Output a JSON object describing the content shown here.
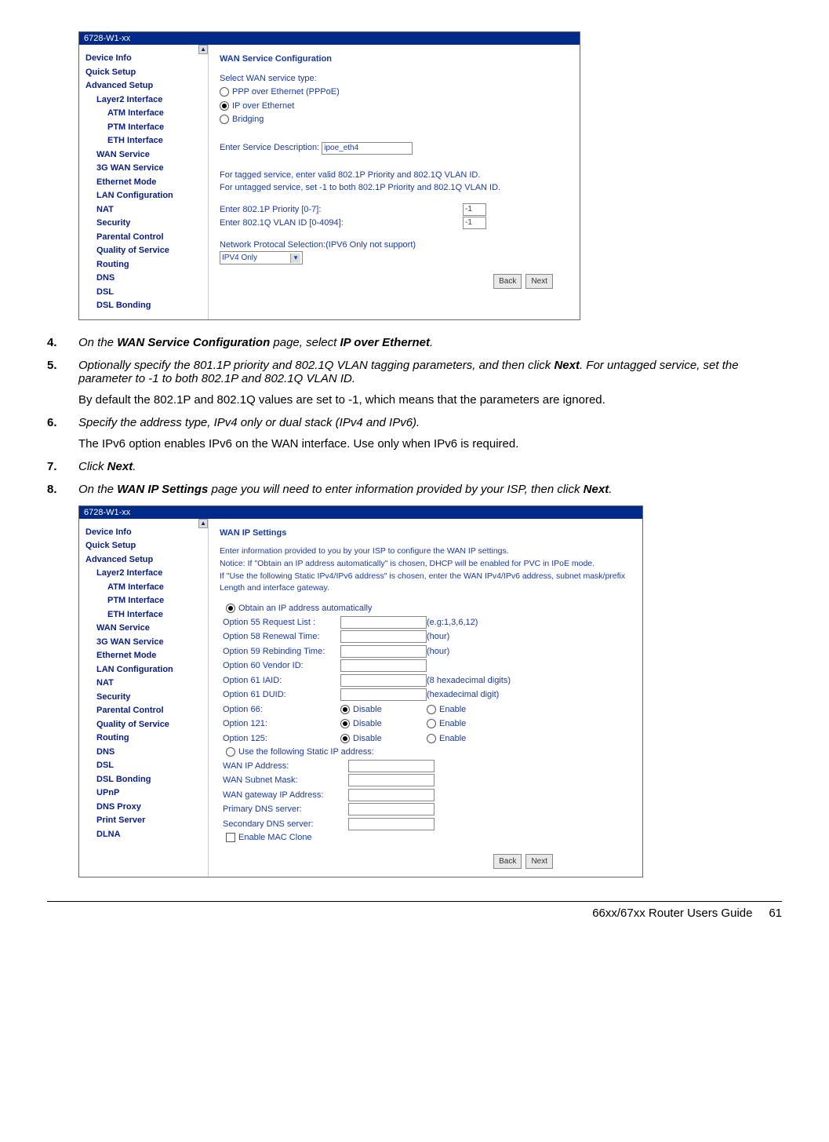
{
  "titlebar": "6728-W1-xx",
  "sidebar": {
    "short": [
      {
        "lvl": 1,
        "label": "Device Info"
      },
      {
        "lvl": 1,
        "label": "Quick Setup"
      },
      {
        "lvl": 1,
        "label": "Advanced Setup"
      },
      {
        "lvl": 2,
        "label": "Layer2 Interface"
      },
      {
        "lvl": 3,
        "label": "ATM Interface"
      },
      {
        "lvl": 3,
        "label": "PTM Interface"
      },
      {
        "lvl": 3,
        "label": "ETH Interface"
      },
      {
        "lvl": 2,
        "label": "WAN Service"
      },
      {
        "lvl": 2,
        "label": "3G WAN Service"
      },
      {
        "lvl": 2,
        "label": "Ethernet Mode"
      },
      {
        "lvl": 2,
        "label": "LAN Configuration"
      },
      {
        "lvl": 2,
        "label": "NAT"
      },
      {
        "lvl": 2,
        "label": "Security"
      },
      {
        "lvl": 2,
        "label": "Parental Control"
      },
      {
        "lvl": 2,
        "label": "Quality of Service"
      },
      {
        "lvl": 2,
        "label": "Routing"
      },
      {
        "lvl": 2,
        "label": "DNS"
      },
      {
        "lvl": 2,
        "label": "DSL"
      },
      {
        "lvl": 2,
        "label": "DSL Bonding"
      }
    ],
    "long": [
      {
        "lvl": 1,
        "label": "Device Info"
      },
      {
        "lvl": 1,
        "label": "Quick Setup"
      },
      {
        "lvl": 1,
        "label": "Advanced Setup"
      },
      {
        "lvl": 2,
        "label": "Layer2 Interface"
      },
      {
        "lvl": 3,
        "label": "ATM Interface"
      },
      {
        "lvl": 3,
        "label": "PTM Interface"
      },
      {
        "lvl": 3,
        "label": "ETH Interface"
      },
      {
        "lvl": 2,
        "label": "WAN Service"
      },
      {
        "lvl": 2,
        "label": "3G WAN Service"
      },
      {
        "lvl": 2,
        "label": "Ethernet Mode"
      },
      {
        "lvl": 2,
        "label": "LAN Configuration"
      },
      {
        "lvl": 2,
        "label": "NAT"
      },
      {
        "lvl": 2,
        "label": "Security"
      },
      {
        "lvl": 2,
        "label": "Parental Control"
      },
      {
        "lvl": 2,
        "label": "Quality of Service"
      },
      {
        "lvl": 2,
        "label": "Routing"
      },
      {
        "lvl": 2,
        "label": "DNS"
      },
      {
        "lvl": 2,
        "label": "DSL"
      },
      {
        "lvl": 2,
        "label": "DSL Bonding"
      },
      {
        "lvl": 2,
        "label": "UPnP"
      },
      {
        "lvl": 2,
        "label": "DNS Proxy"
      },
      {
        "lvl": 2,
        "label": "Print Server"
      },
      {
        "lvl": 2,
        "label": "DLNA"
      }
    ]
  },
  "screenshot1": {
    "heading": "WAN Service Configuration",
    "prompt": "Select WAN service type:",
    "opt1": "PPP over Ethernet (PPPoE)",
    "opt2": "IP over Ethernet",
    "opt3": "Bridging",
    "desc_label": "Enter Service Description:",
    "desc_value": "ipoe_eth4",
    "tagged": "For tagged service, enter valid 802.1P Priority and 802.1Q VLAN ID.",
    "untagged": "For untagged service, set -1 to both 802.1P Priority and 802.1Q VLAN ID.",
    "priority_label": "Enter 802.1P Priority [0-7]:",
    "priority_value": "-1",
    "vlan_label": "Enter 802.1Q VLAN ID [0-4094]:",
    "vlan_value": "-1",
    "proto_label": "Network Protocal Selection:(IPV6 Only not support)",
    "proto_value": "IPV4 Only",
    "back": "Back",
    "next": "Next"
  },
  "screenshot2": {
    "heading": "WAN IP Settings",
    "intro1": "Enter information provided to you by your ISP to configure the WAN IP settings.",
    "intro2": "Notice: If \"Obtain an IP address automatically\" is chosen, DHCP will be enabled for PVC in IPoE mode.",
    "intro3": "If \"Use the following Static IPv4/IPv6 address\" is chosen, enter the WAN IPv4/IPv6 address, subnet mask/prefix Length and interface gateway.",
    "obtain": "Obtain an IP address automatically",
    "opt55_label": "Option 55 Request List :",
    "opt55_hint": "(e.g:1,3,6,12)",
    "opt58_label": "Option 58 Renewal Time:",
    "opt58_hint": "(hour)",
    "opt59_label": "Option 59 Rebinding Time:",
    "opt59_hint": "(hour)",
    "opt60_label": "Option 60 Vendor ID:",
    "opt61i_label": "Option 61 IAID:",
    "opt61i_hint": "(8 hexadecimal digits)",
    "opt61d_label": "Option 61 DUID:",
    "opt61d_hint": "(hexadecimal digit)",
    "opt66_label": "Option 66:",
    "opt121_label": "Option 121:",
    "opt125_label": "Option 125:",
    "disable": "Disable",
    "enable": "Enable",
    "static": "Use the following Static IP address:",
    "wanip": "WAN IP Address:",
    "wanmask": "WAN Subnet Mask:",
    "wangw": "WAN gateway IP Address:",
    "dns1": "Primary DNS server:",
    "dns2": "Secondary DNS server:",
    "mac": "Enable MAC Clone",
    "back": "Back",
    "next": "Next"
  },
  "steps": {
    "s4_num": "4.",
    "s4_a": "On the ",
    "s4_b": "WAN Service Configuration",
    "s4_c": " page, select ",
    "s4_d": "IP over Ethernet",
    "s4_e": ".",
    "s5_num": "5.",
    "s5_a": "Optionally specify the 801.1P priority and 802.1Q VLAN tagging parameters, and then click ",
    "s5_b": "Next",
    "s5_c": ".  For untagged service, set the parameter to -1 to both 802.1P and 802.1Q VLAN ID.",
    "s5_note": "By default the 802.1P and 802.1Q values are set to -1, which means that the parameters are ignored.",
    "s6_num": "6.",
    "s6_a": "Specify the address type, IPv4 only or dual stack (IPv4 and IPv6).",
    "s6_note": "The IPv6 option enables IPv6 on the WAN interface. Use only when IPv6 is required.",
    "s7_num": "7.",
    "s7_a": "Click ",
    "s7_b": "Next",
    "s7_c": ".",
    "s8_num": "8.",
    "s8_a": "On the ",
    "s8_b": "WAN IP Settings",
    "s8_c": " page you will need to enter information provided by your ISP, then click ",
    "s8_d": "Next",
    "s8_e": "."
  },
  "footer": {
    "title": "66xx/67xx Router Users Guide",
    "page": "61"
  }
}
